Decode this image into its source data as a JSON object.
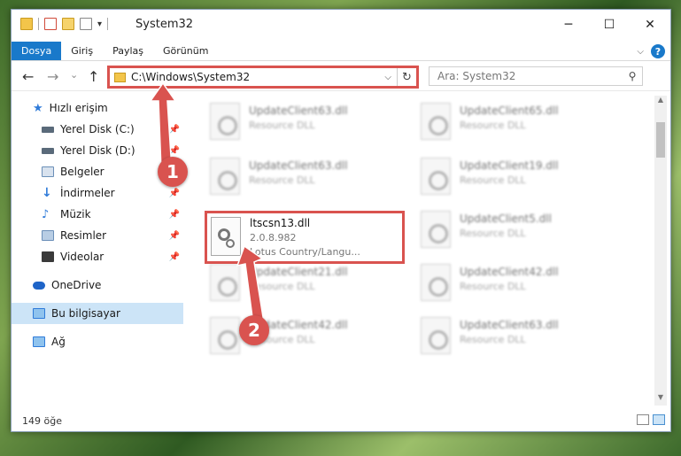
{
  "window": {
    "title": "System32",
    "minimize": "─",
    "maximize": "☐",
    "close": "✕"
  },
  "ribbon": {
    "tabs": [
      "Dosya",
      "Giriş",
      "Paylaş",
      "Görünüm"
    ],
    "help": "?"
  },
  "nav": {
    "back": "←",
    "forward": "→",
    "recent": "⌄",
    "up": "↑",
    "path": "C:\\Windows\\System32",
    "dropdown": "⌵",
    "refresh": "↻"
  },
  "search": {
    "placeholder": "Ara: System32",
    "icon": "search-icon"
  },
  "sidebar": {
    "items": [
      {
        "label": "Hızlı erişim",
        "icon": "star-icon",
        "color": "#2f7bd9"
      },
      {
        "label": "Yerel Disk (C:)",
        "icon": "drive-icon",
        "color": "#5a6a7a"
      },
      {
        "label": "Yerel Disk (D:)",
        "icon": "drive-icon",
        "color": "#5a6a7a"
      },
      {
        "label": "Belgeler",
        "icon": "documents-icon",
        "color": "#6b8fb8"
      },
      {
        "label": "İndirmeler",
        "icon": "downloads-icon",
        "color": "#2f7bd9"
      },
      {
        "label": "Müzik",
        "icon": "music-icon",
        "color": "#2f7bd9"
      },
      {
        "label": "Resimler",
        "icon": "pictures-icon",
        "color": "#6b8fb8"
      },
      {
        "label": "Videolar",
        "icon": "videos-icon",
        "color": "#3a3a3a"
      },
      {
        "label": "OneDrive",
        "icon": "cloud-icon",
        "color": "#1e64c8"
      },
      {
        "label": "Bu bilgisayar",
        "icon": "computer-icon",
        "color": "#2f7bd9"
      },
      {
        "label": "Ağ",
        "icon": "network-icon",
        "color": "#2f7bd9"
      }
    ]
  },
  "files": [
    {
      "name": "UpdateClient63.dll",
      "type": "Resource DLL"
    },
    {
      "name": "UpdateClient65.dll",
      "type": "Resource DLL"
    },
    {
      "name": "UpdateClient63.dll",
      "type": "Resource DLL"
    },
    {
      "name": "UpdateClient19.dll",
      "type": "Resource DLL"
    },
    {
      "name": "UpdateClient5.dll",
      "type": "Resource DLL"
    },
    {
      "name": "UpdateClient21.dll",
      "type": "Resource DLL"
    },
    {
      "name": "UpdateClient42.dll",
      "type": "Resource DLL"
    },
    {
      "name": "UpdateClient42.dll",
      "type": "Resource DLL"
    },
    {
      "name": "UpdateClient63.dll",
      "type": "Resource DLL"
    }
  ],
  "focused_file": {
    "name": "ltscsn13.dll",
    "version": "2.0.8.982",
    "company": "Lotus Country/Langu..."
  },
  "status": {
    "count": "149 öğe"
  },
  "annotations": {
    "step1": "1",
    "step2": "2",
    "accent": "#d9534f"
  }
}
